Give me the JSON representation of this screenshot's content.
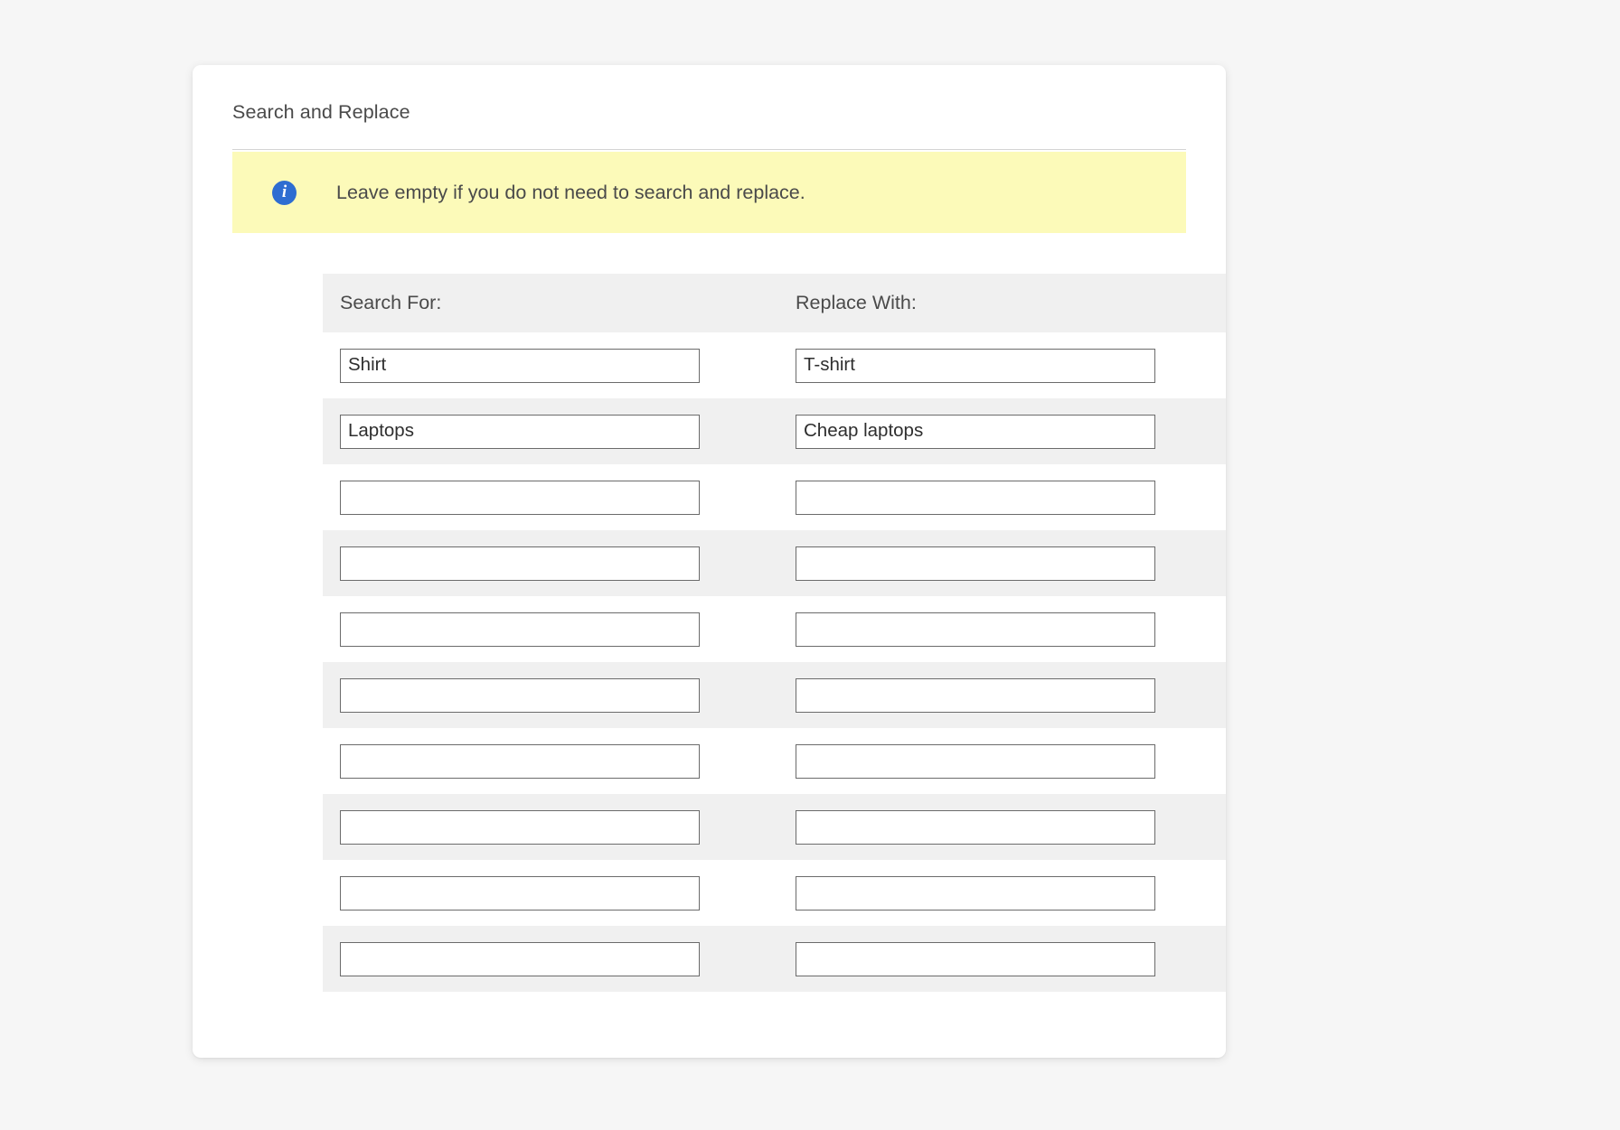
{
  "card": {
    "title": "Search and Replace"
  },
  "notice": {
    "icon": "info-icon",
    "glyph": "i",
    "text": "Leave empty if you do not need to search and replace.",
    "background_color": "#fcfab9",
    "icon_color": "#2e6dd1"
  },
  "table": {
    "columns": [
      {
        "label": "Search For:"
      },
      {
        "label": "Replace With:"
      }
    ],
    "rows": [
      {
        "search": "Shirt",
        "replace": "T-shirt",
        "shaded": false
      },
      {
        "search": "Laptops",
        "replace": "Cheap laptops",
        "shaded": true
      },
      {
        "search": "",
        "replace": "",
        "shaded": false
      },
      {
        "search": "",
        "replace": "",
        "shaded": true
      },
      {
        "search": "",
        "replace": "",
        "shaded": false
      },
      {
        "search": "",
        "replace": "",
        "shaded": true
      },
      {
        "search": "",
        "replace": "",
        "shaded": false
      },
      {
        "search": "",
        "replace": "",
        "shaded": true
      },
      {
        "search": "",
        "replace": "",
        "shaded": false
      },
      {
        "search": "",
        "replace": "",
        "shaded": true
      }
    ]
  },
  "colors": {
    "page_background": "#f6f6f6",
    "card_background": "#ffffff",
    "row_shaded": "#f0f0f0",
    "text": "#4a4a4a",
    "input_border": "#6b6b6b"
  }
}
